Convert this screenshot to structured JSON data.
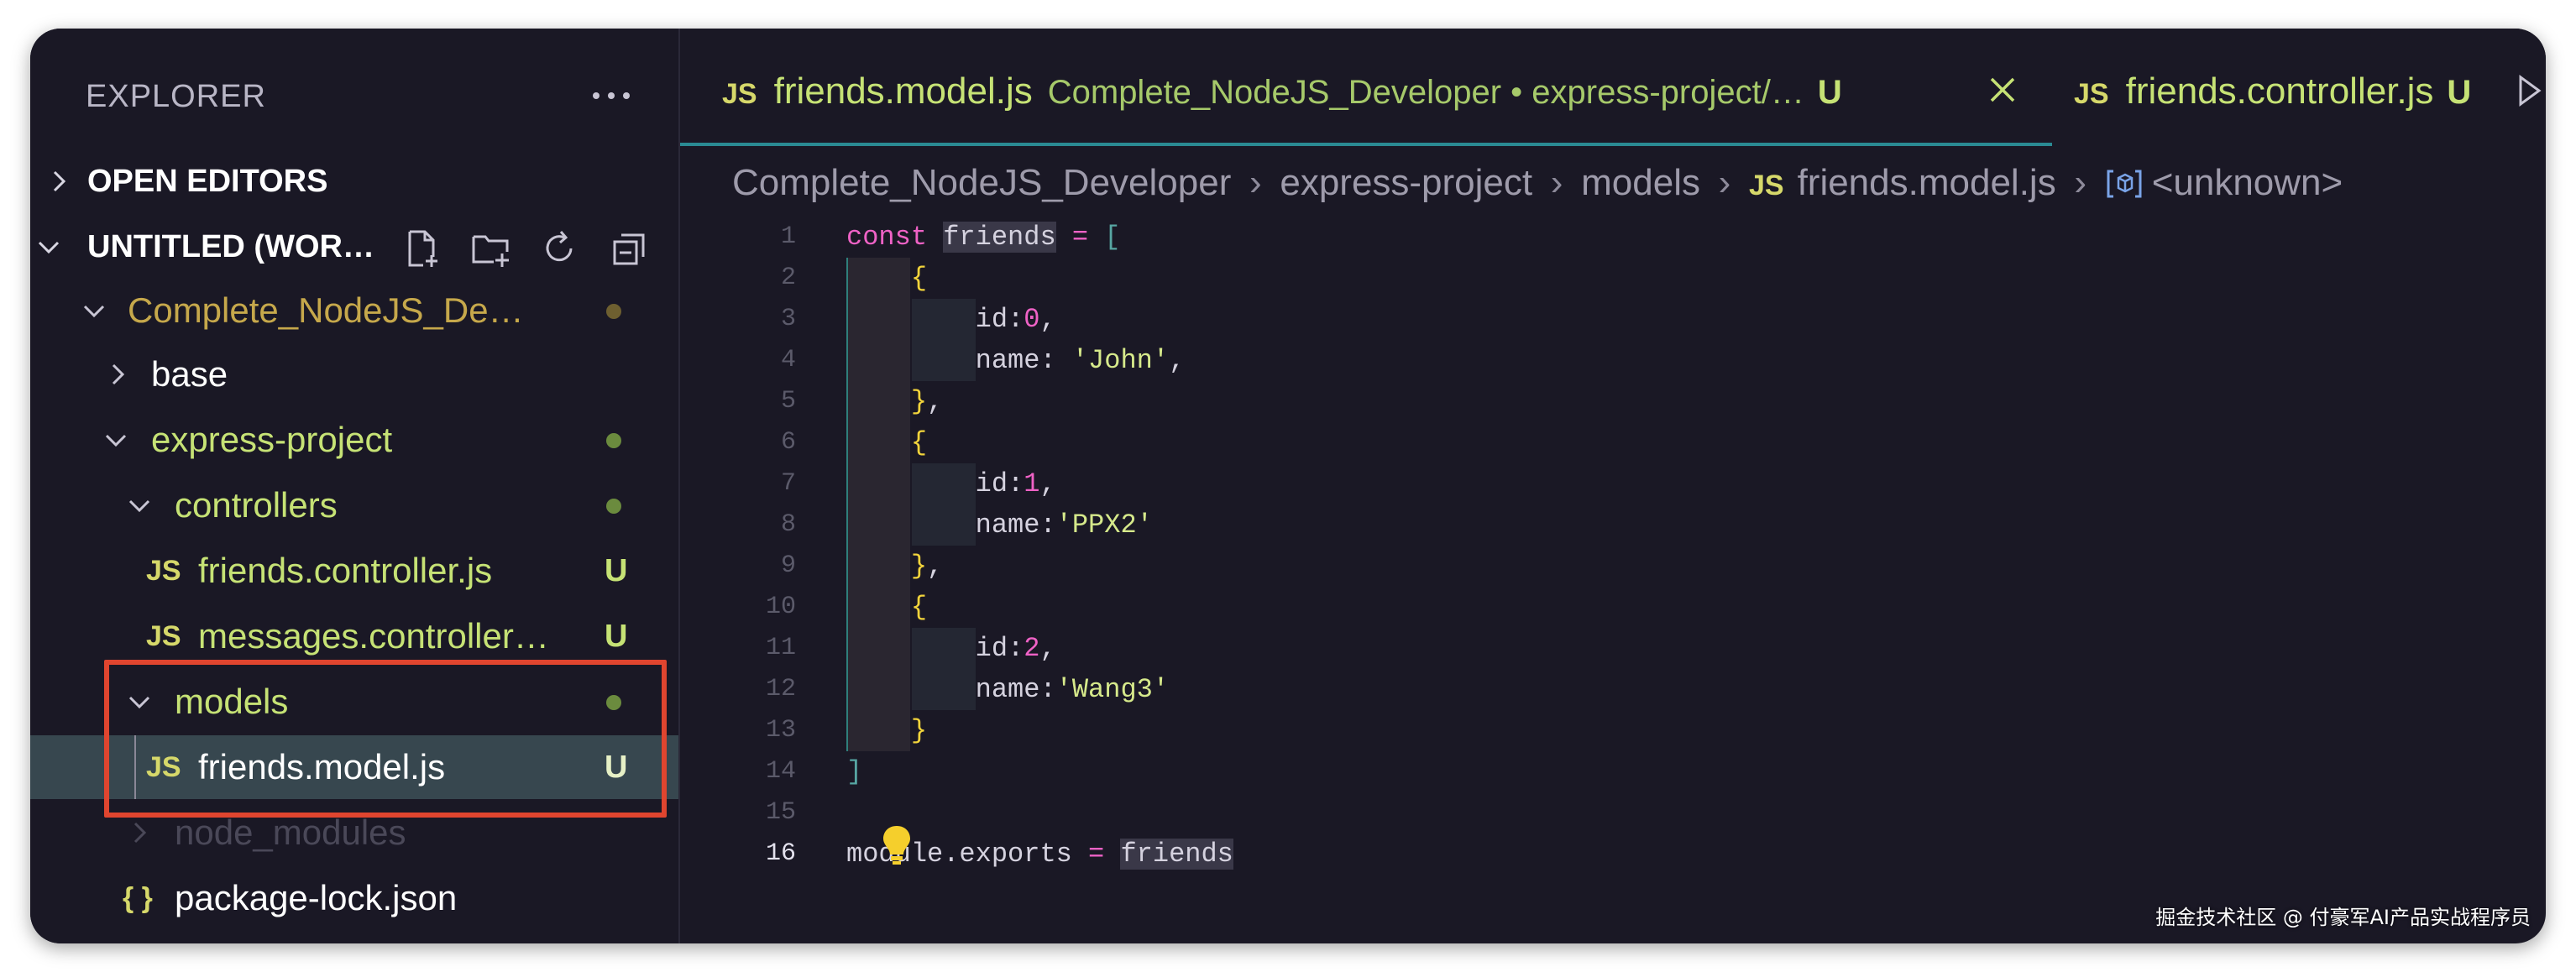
{
  "sidebar": {
    "header": "EXPLORER",
    "open_editors": "OPEN EDITORS",
    "workspace": "UNTITLED (WOR…",
    "tree": [
      {
        "label": "Complete_NodeJS_De…",
        "color": "#c6a84b",
        "expanded": true
      },
      {
        "label": "base",
        "color": "#ffffff",
        "expanded": false
      },
      {
        "label": "express-project",
        "color": "#c6e275",
        "expanded": true
      },
      {
        "label": "controllers",
        "color": "#c6e275",
        "expanded": true
      },
      {
        "label": "friends.controller.js",
        "badge": "U"
      },
      {
        "label": "messages.controller…",
        "badge": "U"
      },
      {
        "label": "models",
        "color": "#c6e275",
        "expanded": true
      },
      {
        "label": "friends.model.js",
        "badge": "U",
        "selected": true
      },
      {
        "label": "node_modules",
        "color": "#4a4858",
        "expanded": false
      },
      {
        "label": "package-lock.json",
        "color": "#ffffff"
      }
    ],
    "js_icon_text": "JS",
    "json_icon_text": "{ }"
  },
  "tabs": [
    {
      "icon": "JS",
      "name": "friends.model.js",
      "path": "Complete_NodeJS_Developer • express-project/…",
      "badge": "U",
      "active": true
    },
    {
      "icon": "JS",
      "name": "friends.controller.js",
      "badge": "U",
      "active": false
    }
  ],
  "breadcrumb": {
    "items": [
      "Complete_NodeJS_Developer",
      "express-project",
      "models"
    ],
    "file_icon": "JS",
    "file": "friends.model.js",
    "symbol": "<unknown>"
  },
  "editor": {
    "line_numbers": [
      "1",
      "2",
      "3",
      "4",
      "5",
      "6",
      "7",
      "8",
      "9",
      "10",
      "11",
      "12",
      "13",
      "14",
      "15",
      "16"
    ],
    "current_line": "16",
    "lines": [
      [
        {
          "t": "const ",
          "c": "kw"
        },
        {
          "t": "friends",
          "c": "var-hl"
        },
        {
          "t": " = ",
          "c": "op"
        },
        {
          "t": "[",
          "c": "brk-g"
        }
      ],
      [
        {
          "t": "    "
        },
        {
          "t": "{",
          "c": "brk-y"
        }
      ],
      [
        {
          "t": "        id:"
        },
        {
          "t": "0",
          "c": "num"
        },
        {
          "t": ","
        }
      ],
      [
        {
          "t": "        name: "
        },
        {
          "t": "'John'",
          "c": "str"
        },
        {
          "t": ","
        }
      ],
      [
        {
          "t": "    "
        },
        {
          "t": "}",
          "c": "brk-y"
        },
        {
          "t": ","
        }
      ],
      [
        {
          "t": "    "
        },
        {
          "t": "{",
          "c": "brk-y"
        }
      ],
      [
        {
          "t": "        id:"
        },
        {
          "t": "1",
          "c": "num"
        },
        {
          "t": ","
        }
      ],
      [
        {
          "t": "        name:"
        },
        {
          "t": "'PPX2'",
          "c": "str"
        }
      ],
      [
        {
          "t": "    "
        },
        {
          "t": "}",
          "c": "brk-y"
        },
        {
          "t": ","
        }
      ],
      [
        {
          "t": "    "
        },
        {
          "t": "{",
          "c": "brk-y"
        }
      ],
      [
        {
          "t": "        id:"
        },
        {
          "t": "2",
          "c": "num"
        },
        {
          "t": ","
        }
      ],
      [
        {
          "t": "        name:"
        },
        {
          "t": "'Wang3'",
          "c": "str"
        }
      ],
      [
        {
          "t": "    "
        },
        {
          "t": "}",
          "c": "brk-y"
        }
      ],
      [
        {
          "t": "]",
          "c": "brk-g"
        }
      ],
      [
        {
          "t": ""
        }
      ],
      [
        {
          "t": "module.exports "
        },
        {
          "t": "= ",
          "c": "op"
        },
        {
          "t": "friends",
          "c": "var-hl"
        }
      ]
    ]
  },
  "watermark": "掘金技术社区 @ 付豪军AI产品实战程序员",
  "colors": {
    "background": "#1a1825",
    "accent_tab_border": "#2a8a93",
    "highlight_box": "#e0452f",
    "untracked_green": "#c6e275",
    "js_yellow": "#d6d86a"
  }
}
